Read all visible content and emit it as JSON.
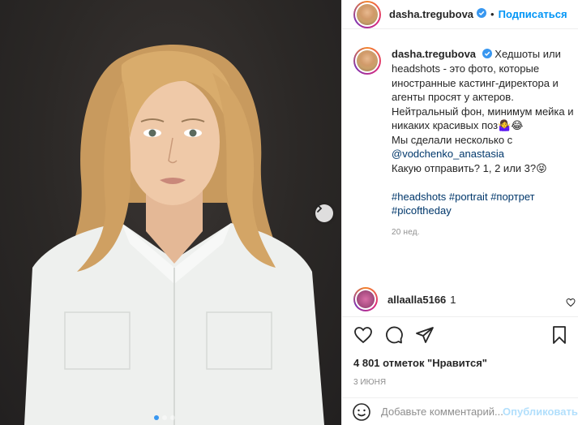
{
  "post": {
    "username": "dasha.tregubova",
    "subscribe_label": "Подписаться",
    "separator": "•"
  },
  "caption": {
    "username": "dasha.tregubova",
    "line1": "Хедшоты или headshots - это фото, которые иностранные кастинг-директора и агенты просят у актеров. Нейтральный фон, минимум мейка и никаких красивых поз🤷‍♀️😂",
    "line2_prefix": "Мы сделали несколько с ",
    "mention": "@vodchenko_anastasia",
    "line3": "Какую отправить? 1, 2 или 3?😝",
    "hashtags": [
      "#headshots",
      "#portrait",
      "#портрет",
      "#picoftheday"
    ],
    "time": "20 нед."
  },
  "comment": {
    "username": "allaalla5166",
    "text": "1"
  },
  "actions": {
    "likes": "4 801 отметок \"Нравится\"",
    "date": "3 ИЮНЯ"
  },
  "comment_box": {
    "placeholder": "Добавьте комментарий...",
    "publish_label": "Опубликовать"
  },
  "icons": [
    "verified-badge-icon",
    "heart-icon",
    "comment-icon",
    "share-icon",
    "bookmark-icon",
    "chevron-right-icon",
    "emoji-icon"
  ],
  "colors": {
    "accent": "#0095f6",
    "link": "#00376b",
    "muted": "#8e8e8e",
    "publish_disabled": "#b2dffc"
  },
  "carousel": {
    "slide_count": 3,
    "active_slide": 1
  }
}
